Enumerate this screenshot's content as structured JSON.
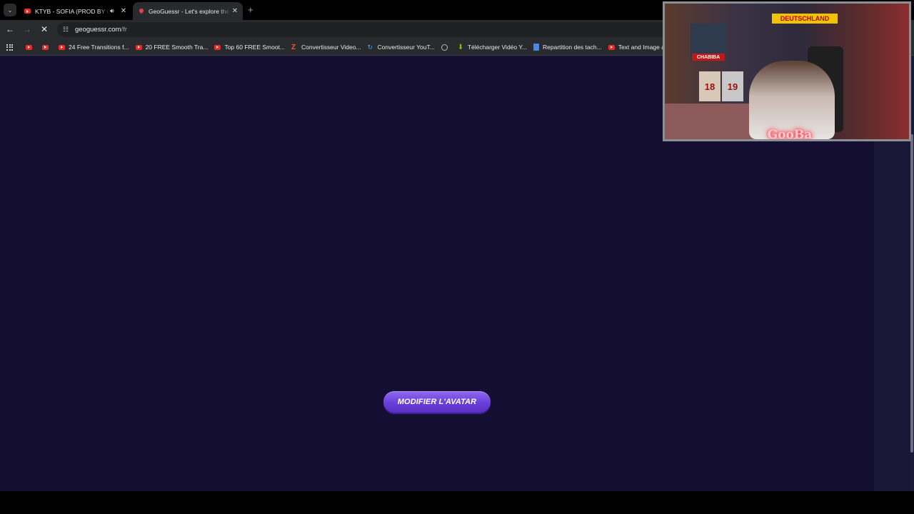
{
  "browser": {
    "tabs": [
      {
        "title": "KTYB - SOFIA (PROD BY GA",
        "audio": true,
        "active": false
      },
      {
        "title": "GeoGuessr - Let's explore the w",
        "audio": false,
        "active": true
      }
    ],
    "address_bar": {
      "domain": "geoguessr.com",
      "path": "/fr"
    },
    "bookmarks": [
      {
        "label": "",
        "icon": "youtube-icon"
      },
      {
        "label": "",
        "icon": "youtube-icon"
      },
      {
        "label": "24 Free Transitions f...",
        "icon": "youtube-icon"
      },
      {
        "label": "20 FREE Smooth Tra...",
        "icon": "youtube-icon"
      },
      {
        "label": "Top 60 FREE Smoot...",
        "icon": "youtube-icon"
      },
      {
        "label": "Convertisseur Video...",
        "icon": "z-icon"
      },
      {
        "label": "Convertisseur YouT...",
        "icon": "convert-icon"
      },
      {
        "label": "",
        "icon": "globe-icon"
      },
      {
        "label": "Télécharger Vidéo Y...",
        "icon": "download-icon"
      },
      {
        "label": "Repartition des tach...",
        "icon": "doc-icon"
      },
      {
        "label": "Text and Image ani...",
        "icon": "youtube-icon"
      }
    ]
  },
  "page": {
    "avatar_button_label": "MODIFIER L'AVATAR",
    "background_color": "#140f32",
    "button_color": "#7a4fe6"
  },
  "webcam": {
    "logo_text": "GooBa",
    "banner_text": "DEUTSCHLAND",
    "poster_text": "CHABIBA",
    "jersey_numbers": [
      "18",
      "19"
    ]
  }
}
